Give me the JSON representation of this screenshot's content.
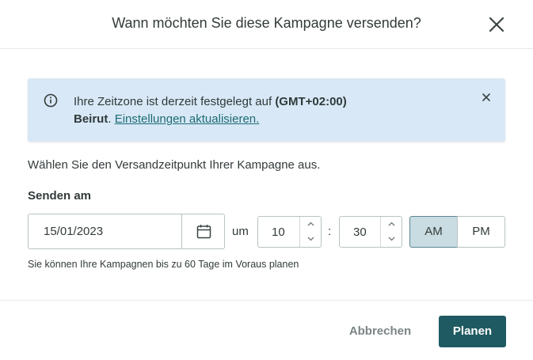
{
  "dialog": {
    "title": "Wann möchten Sie diese Kampagne versenden?",
    "close_icon": "close-icon"
  },
  "alert": {
    "icon": "info-icon",
    "text_prefix": "Ihre Zeitzone ist derzeit festgelegt auf ",
    "timezone": "(GMT+02:00)",
    "city": "Beirut",
    "separator": ". ",
    "link": "Einstellungen aktualisieren.",
    "close_icon": "close-icon",
    "background": "#d8e8f6"
  },
  "schedule": {
    "intro": "Wählen Sie den Versandzeitpunkt Ihrer Kampagne aus.",
    "label": "Senden am",
    "date": "15/01/2023",
    "calendar_icon": "calendar-icon",
    "at_label": "um",
    "hour": "10",
    "colon": ":",
    "minute": "30",
    "am": "AM",
    "pm": "PM",
    "selected_period": "AM",
    "hint": "Sie können Ihre Kampagnen bis zu 60 Tage im Voraus planen"
  },
  "footer": {
    "cancel": "Abbrechen",
    "submit": "Planen",
    "primary_color": "#1f5a62"
  }
}
